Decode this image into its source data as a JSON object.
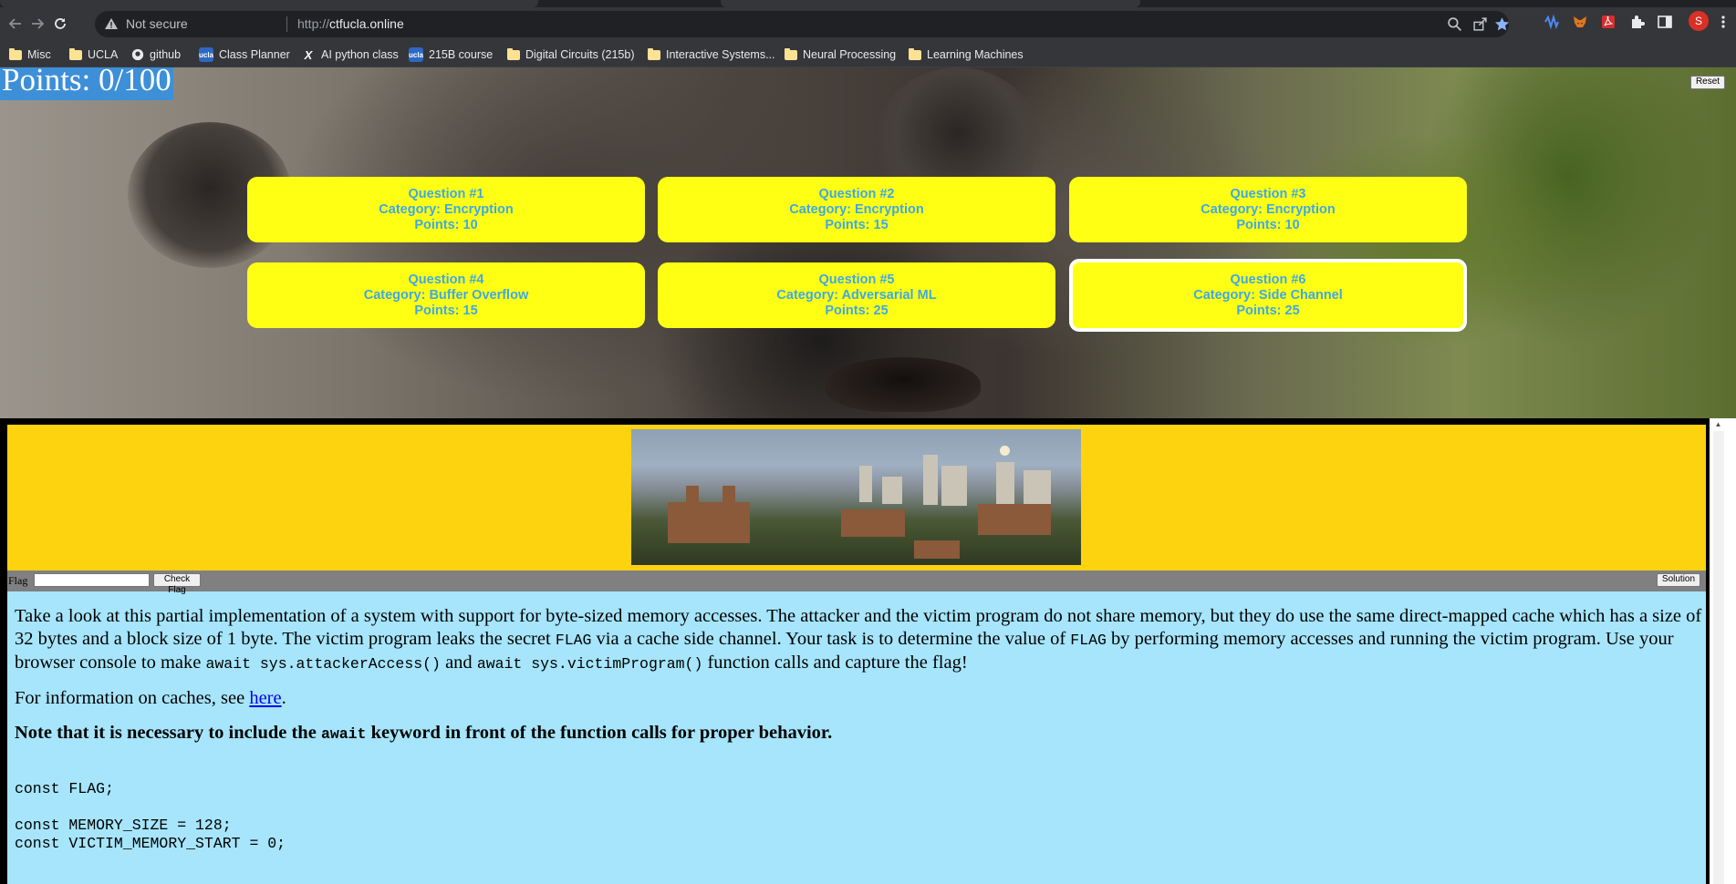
{
  "browser": {
    "security_label": "Not secure",
    "url_scheme": "http://",
    "url_host": "ctfucla.online",
    "profile_initial": "S",
    "bookmarks": [
      {
        "label": "Misc",
        "icon": "folder-icon"
      },
      {
        "label": "UCLA",
        "icon": "folder-icon"
      },
      {
        "label": "github",
        "icon": "github-icon"
      },
      {
        "label": "Class Planner",
        "icon": "ucla-icon"
      },
      {
        "label": "AI python class",
        "icon": "x-icon"
      },
      {
        "label": "215B course",
        "icon": "ucla-icon"
      },
      {
        "label": "Digital Circuits (215b)",
        "icon": "folder-icon"
      },
      {
        "label": "Interactive Systems...",
        "icon": "folder-icon"
      },
      {
        "label": "Neural Processing",
        "icon": "folder-icon"
      },
      {
        "label": "Learning Machines",
        "icon": "folder-icon"
      }
    ]
  },
  "header": {
    "points": "Points: 0/100",
    "reset_label": "Reset"
  },
  "questions": [
    {
      "title": "Question #1",
      "category": "Category: Encryption",
      "points": "Points: 10"
    },
    {
      "title": "Question #2",
      "category": "Category: Encryption",
      "points": "Points: 15"
    },
    {
      "title": "Question #3",
      "category": "Category: Encryption",
      "points": "Points: 10"
    },
    {
      "title": "Question #4",
      "category": "Category: Buffer Overflow",
      "points": "Points: 15"
    },
    {
      "title": "Question #5",
      "category": "Category: Adversarial ML",
      "points": "Points: 25"
    },
    {
      "title": "Question #6",
      "category": "Category: Side Channel",
      "points": "Points: 25",
      "selected": true
    }
  ],
  "challenge": {
    "flag_label": "Flag",
    "flag_value": "",
    "check_label": "Check Flag",
    "solution_label": "Solution",
    "intro_1": "Take a look at this partial implementation of a system with support for byte-sized memory accesses. The attacker and the victim program do not share memory, but they do use the same direct-mapped cache which has a size of 32 bytes and a block size of 1 byte. The victim program leaks the secret ",
    "flag_code": "FLAG",
    "intro_2": " via a cache side channel. Your task is to determine the value of ",
    "intro_3": " by performing memory accesses and running the victim program. Use your browser console to make ",
    "attacker_call": "await sys.attackerAccess()",
    "intro_and": " and ",
    "victim_call": "await sys.victimProgram()",
    "intro_4": " function calls and capture the flag!",
    "info_prefix": "For information on caches, see ",
    "info_link": "here",
    "info_suffix": ".",
    "note_prefix": "Note that it is necessary to include the ",
    "note_code": "await",
    "note_suffix": " keyword in front of the function calls for proper behavior.",
    "code_lines": [
      "const FLAG;",
      "",
      "const MEMORY_SIZE = 128;",
      "const VICTIM_MEMORY_START = 0;"
    ]
  }
}
